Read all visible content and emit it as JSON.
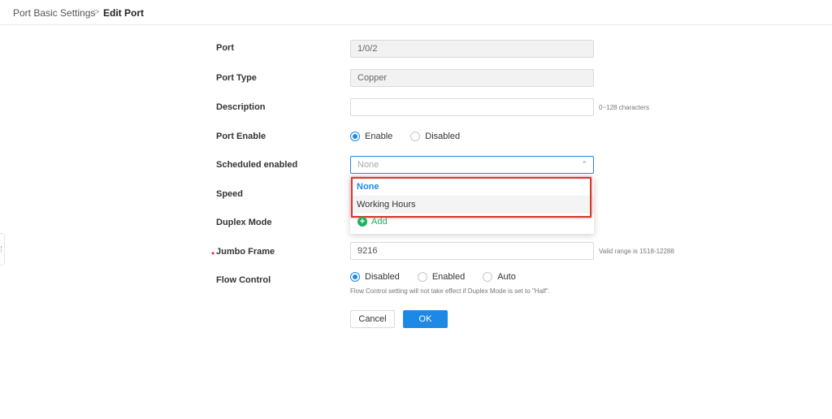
{
  "breadcrumb": {
    "root": "Port Basic Settings",
    "separator": ">",
    "current": "Edit Port"
  },
  "form": {
    "port": {
      "label": "Port",
      "value": "1/0/2"
    },
    "port_type": {
      "label": "Port Type",
      "value": "Copper"
    },
    "description": {
      "label": "Description",
      "value": "",
      "hint": "0~128 characters"
    },
    "port_enable": {
      "label": "Port Enable",
      "options": [
        "Enable",
        "Disabled"
      ],
      "selected": "Enable"
    },
    "scheduled": {
      "label": "Scheduled enabled",
      "placeholder": "None",
      "dropdown_options": [
        "None",
        "Working Hours"
      ],
      "selected": "None",
      "add_label": "Add"
    },
    "speed": {
      "label": "Speed"
    },
    "duplex": {
      "label": "Duplex Mode"
    },
    "jumbo": {
      "label": "Jumbo Frame",
      "required_mark": "•",
      "value": "9216",
      "hint": "Valid range is 1518-12288"
    },
    "flow_control": {
      "label": "Flow Control",
      "options": [
        "Disabled",
        "Enabled",
        "Auto"
      ],
      "selected": "Disabled",
      "note": "Flow Control setting will not take effect if Duplex Mode is set to \"Half\"."
    }
  },
  "buttons": {
    "cancel": "Cancel",
    "ok": "OK"
  },
  "colors": {
    "accent": "#1e88e5",
    "add_green": "#21b060",
    "highlight_red": "#d13b30"
  },
  "icons": {
    "chevron": "chevron-up-icon",
    "add": "plus-circle-icon",
    "side": "drag-handle-icon"
  }
}
